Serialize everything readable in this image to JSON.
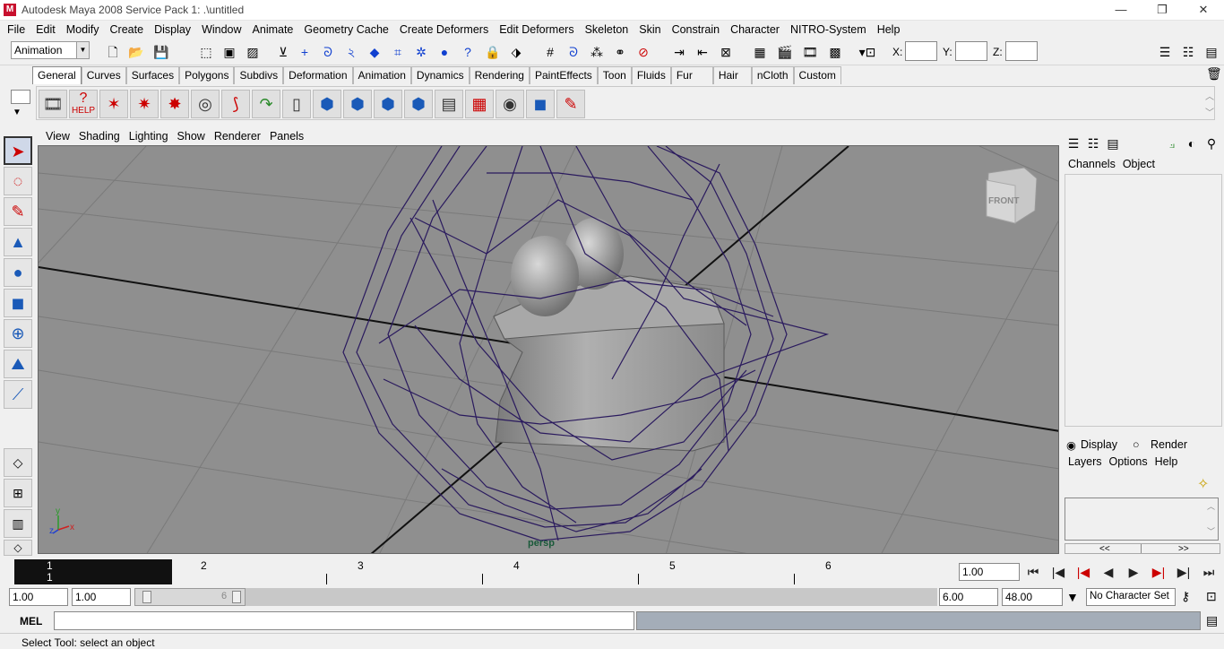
{
  "window": {
    "title": "Autodesk Maya 2008 Service Pack 1: .\\untitled",
    "minimize": "—",
    "maximize": "❐",
    "close": "✕"
  },
  "menubar": [
    "File",
    "Edit",
    "Modify",
    "Create",
    "Display",
    "Window",
    "Animate",
    "Geometry Cache",
    "Create Deformers",
    "Edit Deformers",
    "Skeleton",
    "Skin",
    "Constrain",
    "Character",
    "NITRO-System",
    "Help"
  ],
  "statusline": {
    "menuset": "Animation",
    "x_label": "X:",
    "y_label": "Y:",
    "z_label": "Z:"
  },
  "shelf_tabs": [
    "General",
    "Curves",
    "Surfaces",
    "Polygons",
    "Subdivs",
    "Deformation",
    "Animation",
    "Dynamics",
    "Rendering",
    "PaintEffects",
    "Toon",
    "Fluids",
    "Fur",
    "Hair",
    "nCloth",
    "Custom"
  ],
  "shelf": {
    "help_label": "HELP"
  },
  "panel_menu": [
    "View",
    "Shading",
    "Lighting",
    "Show",
    "Renderer",
    "Panels"
  ],
  "viewport": {
    "camera_label": "persp",
    "viewcube_label": "FRONT",
    "axis_x": "x",
    "axis_y": "y",
    "axis_z": "z"
  },
  "channel_box": {
    "tabs": [
      "Channels",
      "Object"
    ],
    "display_radio": "Display",
    "render_radio": "Render",
    "layer_menu": [
      "Layers",
      "Options",
      "Help"
    ],
    "scroll_left": "<<",
    "scroll_right": ">>"
  },
  "time_slider": {
    "current_frame_top": "1",
    "current_frame_bottom": "1",
    "ticks": [
      "2",
      "3",
      "4",
      "5",
      "6"
    ],
    "current_time": "1.00"
  },
  "range_slider": {
    "start_time": "1.00",
    "playback_start": "1.00",
    "playback_end": "6.00",
    "end_time": "48.00",
    "handle_value": "6",
    "character_set": "No Character Set"
  },
  "command_line": {
    "label": "MEL"
  },
  "help_line": {
    "text": "Select Tool: select an object"
  },
  "colors": {
    "viewport_bg": "#8f8f8f",
    "wireframe": "#2a1a5e",
    "time_cursor": "#111111",
    "command_result_bg": "#a4adb8"
  }
}
